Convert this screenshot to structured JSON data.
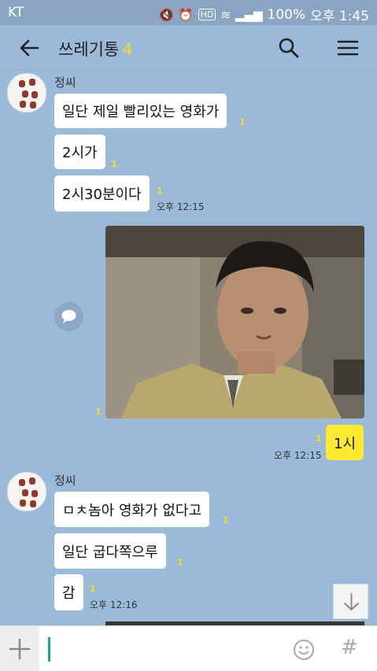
{
  "status_bar": {
    "carrier": "KT",
    "battery": "100%",
    "time": "오후 1:45"
  },
  "header": {
    "title": "쓰레기통",
    "member_count": "4",
    "icons": [
      "back-arrow-icon",
      "search-icon",
      "menu-icon"
    ]
  },
  "messages": [
    {
      "sender": "정씨",
      "text": "일단 제일 빨리있는 영화가",
      "unread": "1"
    },
    {
      "text": "2시가",
      "unread": "1"
    },
    {
      "text": "2시30분이다",
      "unread": "1",
      "time": "오후 12:15"
    },
    {
      "type": "image",
      "unread": "1"
    },
    {
      "mine": true,
      "text": "1시",
      "unread": "1",
      "time": "오후 12:15"
    },
    {
      "sender": "정씨",
      "text": "ㅁㅊ놈아 영화가 없다고",
      "unread": "1"
    },
    {
      "text": "일단 굽다쪽으루",
      "unread": "1"
    },
    {
      "text": "감",
      "unread": "1",
      "time": "오후 12:16"
    }
  ],
  "input": {
    "placeholder": "",
    "icons": [
      "plus-icon",
      "emoji-icon",
      "hash-icon"
    ]
  },
  "colors": {
    "background": "#9bbad9",
    "my_bubble": "#fde92f",
    "unread": "#f2e017",
    "cursor": "#17a59a"
  }
}
